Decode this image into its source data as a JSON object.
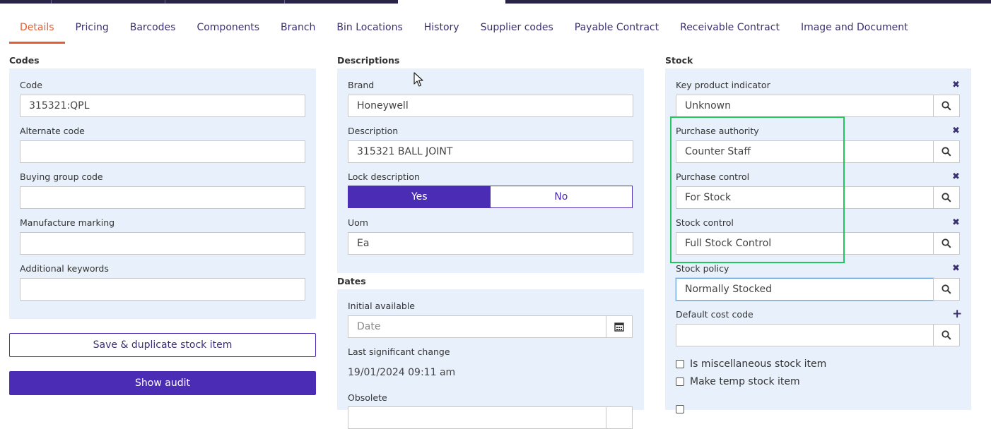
{
  "tabs": [
    "Details",
    "Pricing",
    "Barcodes",
    "Components",
    "Branch",
    "Bin Locations",
    "History",
    "Supplier codes",
    "Payable Contract",
    "Receivable Contract",
    "Image and Document"
  ],
  "active_tab": "Details",
  "codes": {
    "title": "Codes",
    "code_label": "Code",
    "code_value": "315321:QPL",
    "alternate_label": "Alternate code",
    "alternate_value": "",
    "buying_label": "Buying group code",
    "buying_value": "",
    "manufacture_label": "Manufacture marking",
    "manufacture_value": "",
    "keywords_label": "Additional keywords",
    "keywords_value": "",
    "save_dup_label": "Save & duplicate stock item",
    "show_audit_label": "Show audit"
  },
  "descriptions": {
    "title": "Descriptions",
    "brand_label": "Brand",
    "brand_value": "Honeywell",
    "description_label": "Description",
    "description_value": "315321 BALL JOINT",
    "lock_label": "Lock description",
    "yes_label": "Yes",
    "no_label": "No",
    "uom_label": "Uom",
    "uom_value": "Ea"
  },
  "dates": {
    "title": "Dates",
    "initial_label": "Initial available",
    "initial_placeholder": "Date",
    "last_change_label": "Last significant change",
    "last_change_value": "19/01/2024 09:11 am",
    "obsolete_label": "Obsolete"
  },
  "stock": {
    "title": "Stock",
    "key_label": "Key product indicator",
    "key_value": "Unknown",
    "authority_label": "Purchase authority",
    "authority_value": "Counter Staff",
    "control_label": "Purchase control",
    "control_value": "For Stock",
    "stock_control_label": "Stock control",
    "stock_control_value": "Full Stock Control",
    "policy_label": "Stock policy",
    "policy_value": "Normally Stocked",
    "cost_label": "Default cost code",
    "cost_value": "",
    "misc_label": "Is miscellaneous stock item",
    "temp_label": "Make temp stock item"
  },
  "colors": {
    "accent": "#4b2db5",
    "active_tab": "#e35d2f",
    "panel_bg": "#e8f1fb",
    "highlight": "#22c55e"
  },
  "icons": {
    "search": "search-icon",
    "clear": "close-icon",
    "add": "plus-icon",
    "calendar": "calendar-icon"
  }
}
